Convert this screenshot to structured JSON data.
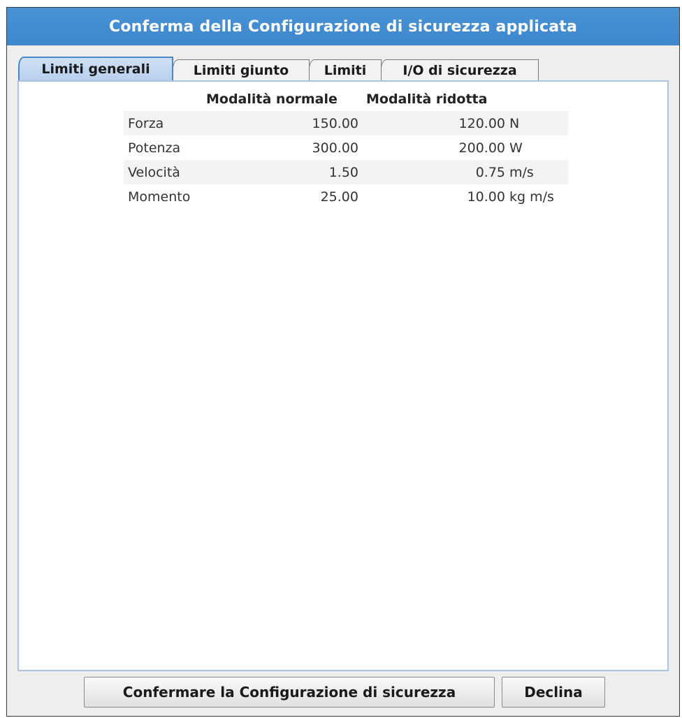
{
  "dialog": {
    "title": "Conferma della Configurazione di sicurezza applicata"
  },
  "tabs": [
    {
      "label": "Limiti generali",
      "active": true
    },
    {
      "label": "Limiti giunto",
      "active": false
    },
    {
      "label": "Limiti",
      "active": false
    },
    {
      "label": "I/O di sicurezza",
      "active": false
    }
  ],
  "table": {
    "headers": {
      "normal": "Modalità normale",
      "reduced": "Modalità ridotta"
    },
    "rows": [
      {
        "name": "Forza",
        "normal": "150.00",
        "reduced": "120.00",
        "unit": "N"
      },
      {
        "name": "Potenza",
        "normal": "300.00",
        "reduced": "200.00",
        "unit": "W"
      },
      {
        "name": "Velocità",
        "normal": "1.50",
        "reduced": "0.75",
        "unit": "m/s"
      },
      {
        "name": "Momento",
        "normal": "25.00",
        "reduced": "10.00",
        "unit": "kg m/s"
      }
    ]
  },
  "buttons": {
    "confirm": "Confermare la Configurazione di sicurezza",
    "decline": "Declina"
  },
  "colors": {
    "titlebar": "#3c86cd",
    "active_tab": "#b8d0ee",
    "panel_border": "#a9c4e4",
    "row_shade": "#f5f2f4"
  }
}
